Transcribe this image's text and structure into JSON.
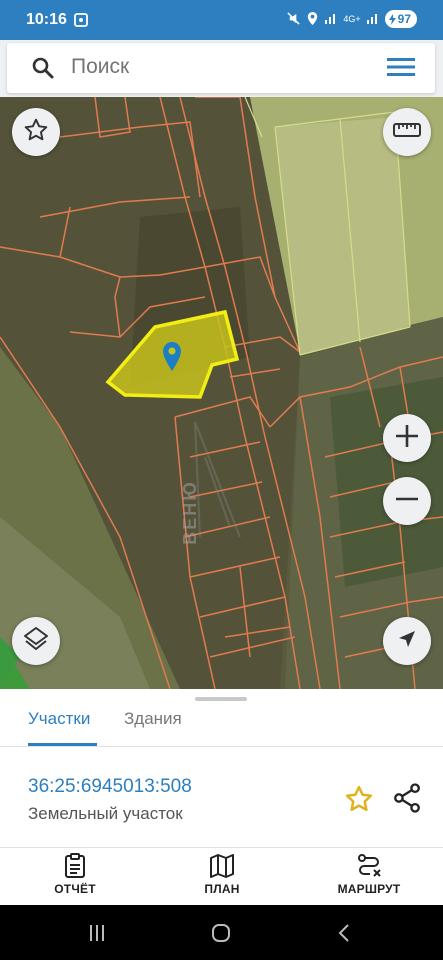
{
  "status_bar": {
    "time": "10:16",
    "network": "4G+",
    "battery": "97"
  },
  "search": {
    "placeholder": "Поиск"
  },
  "map": {
    "parcel_highlight_color": "#d8d31a",
    "boundary_color": "#e07b4f",
    "watermark": "ВЕНЮ"
  },
  "sheet": {
    "tabs": [
      {
        "label": "Участки",
        "active": true
      },
      {
        "label": "Здания",
        "active": false
      }
    ],
    "parcel": {
      "cadastral_number": "36:25:6945013:508",
      "type": "Земельный участок"
    }
  },
  "bottom_nav": [
    {
      "label": "ОТЧЁТ",
      "icon": "report-icon"
    },
    {
      "label": "ПЛАН",
      "icon": "map-icon"
    },
    {
      "label": "МАРШРУТ",
      "icon": "route-icon"
    }
  ],
  "colors": {
    "accent": "#2d7fc0",
    "status_bar": "#2d7fc0",
    "favorite": "#e0b21d"
  }
}
